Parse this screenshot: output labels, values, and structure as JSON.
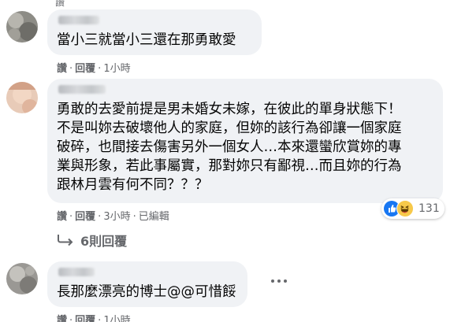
{
  "top_crop": "讚",
  "comments": [
    {
      "text": "當小三就當小三還在那勇敢愛",
      "actions": {
        "like": "讚",
        "reply": "回覆",
        "time": "1小時"
      }
    },
    {
      "text_lines": [
        "勇敢的去愛前提是男未婚女未嫁，在彼此的單身狀態下！",
        "不是叫妳去破壞他人的家庭，但妳的該行為卻讓一個家庭",
        "破碎，也間接去傷害另外一個女人…本來還蠻欣賞妳的專",
        "業與形象，若此事屬實，那對妳只有鄙視…而且妳的行為",
        "跟林月雲有何不同？？？"
      ],
      "actions": {
        "like": "讚",
        "reply": "回覆",
        "time": "3小時",
        "edited": "已編輯"
      },
      "reactions": {
        "icons": [
          "like-icon",
          "haha-icon"
        ],
        "count": "131"
      },
      "more_replies": "6則回覆"
    },
    {
      "text": "長那麼漂亮的博士@@可惜餒",
      "actions": {
        "like": "讚",
        "reply": "回覆",
        "time": "1小時"
      }
    }
  ],
  "colors": {
    "bubble": "#f0f2f5",
    "text": "#050505",
    "secondary": "#65676b",
    "like_blue": "#1877f2",
    "haha_yellow": "#f7c94a"
  }
}
